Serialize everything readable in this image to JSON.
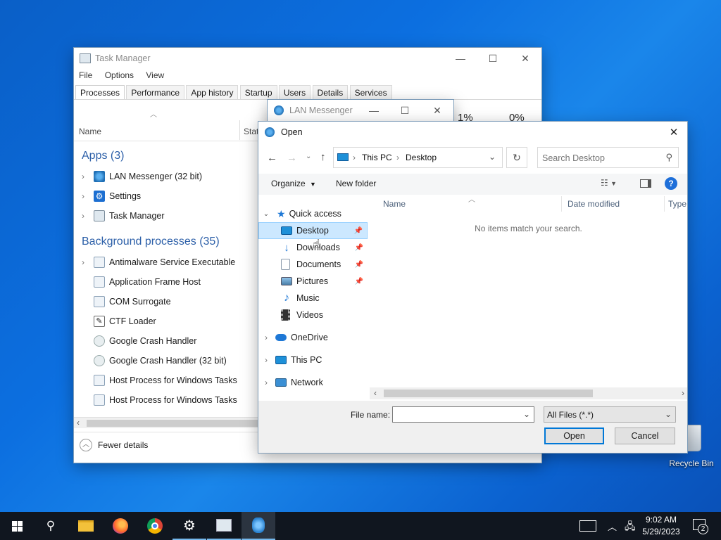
{
  "desktop": {
    "recycle_bin_label": "Recycle Bin"
  },
  "task_manager": {
    "title": "Task Manager",
    "menu": [
      "File",
      "Options",
      "View"
    ],
    "tabs": [
      "Processes",
      "Performance",
      "App history",
      "Startup",
      "Users",
      "Details",
      "Services"
    ],
    "columns": {
      "name": "Name",
      "status": "Stat",
      "cpu": "1%",
      "memory": "0%"
    },
    "apps_header": "Apps (3)",
    "apps": [
      "LAN Messenger (32 bit)",
      "Settings",
      "Task Manager"
    ],
    "background_header": "Background processes (35)",
    "background": [
      "Antimalware Service Executable",
      "Application Frame Host",
      "COM Surrogate",
      "CTF Loader",
      "Google Crash Handler",
      "Google Crash Handler (32 bit)",
      "Host Process for Windows Tasks",
      "Host Process for Windows Tasks"
    ],
    "fewer_details": "Fewer details"
  },
  "lan_messenger": {
    "title": "LAN Messenger"
  },
  "open_dialog": {
    "title": "Open",
    "breadcrumb": [
      "This PC",
      "Desktop"
    ],
    "search_placeholder": "Search Desktop",
    "toolbar": {
      "organize": "Organize",
      "new_folder": "New folder"
    },
    "nav": {
      "quick_access": "Quick access",
      "quick_items": [
        "Desktop",
        "Downloads",
        "Documents",
        "Pictures",
        "Music",
        "Videos"
      ],
      "onedrive": "OneDrive",
      "this_pc": "This PC",
      "network": "Network"
    },
    "columns": {
      "name": "Name",
      "date_modified": "Date modified",
      "type": "Type"
    },
    "empty_message": "No items match your search.",
    "file_name_label": "File name:",
    "file_name_value": "",
    "file_type": "All Files (*.*)",
    "open_button": "Open",
    "cancel_button": "Cancel"
  },
  "taskbar": {
    "time": "9:02 AM",
    "date": "5/29/2023",
    "notification_count": "2"
  }
}
